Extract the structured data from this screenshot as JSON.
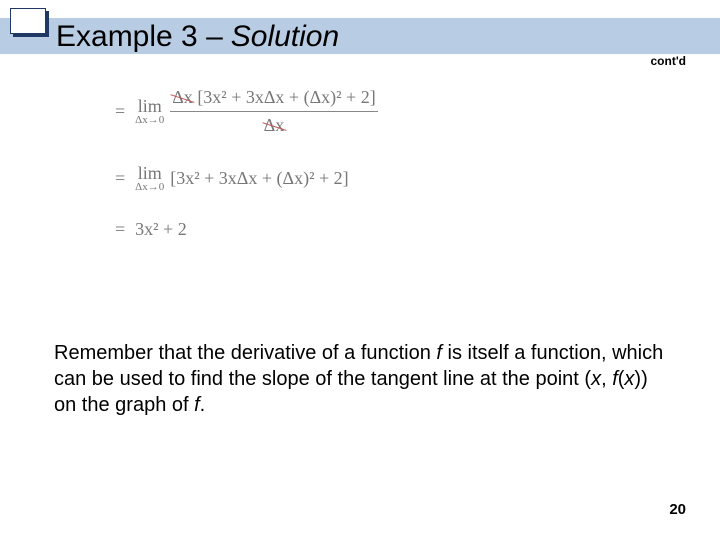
{
  "header": {
    "title_prefix": "Example 3 – ",
    "title_italic": "Solution",
    "contd": "cont'd"
  },
  "math": {
    "eq1": {
      "eq": "=",
      "lim_top": "lim",
      "lim_bot": "Δx→0",
      "num_cancel": "Δx",
      "num_rest": " [3x² + 3xΔx + (Δx)² + 2]",
      "den_cancel": "Δx"
    },
    "eq2": {
      "eq": "=",
      "lim_top": "lim",
      "lim_bot": "Δx→0",
      "expr": "[3x² + 3xΔx + (Δx)² + 2]"
    },
    "eq3": {
      "eq": "=",
      "expr": "3x² + 2"
    }
  },
  "body": {
    "t1": "Remember that the derivative of a function ",
    "f1": "f",
    "t2": " is itself a function, which can be used to find the slope of the tangent line at the point (",
    "x": "x",
    "t3": ", ",
    "f2": "f",
    "t4": "(",
    "x2": "x",
    "t5": ")) on the graph of ",
    "f3": "f",
    "t6": "."
  },
  "page": "20"
}
